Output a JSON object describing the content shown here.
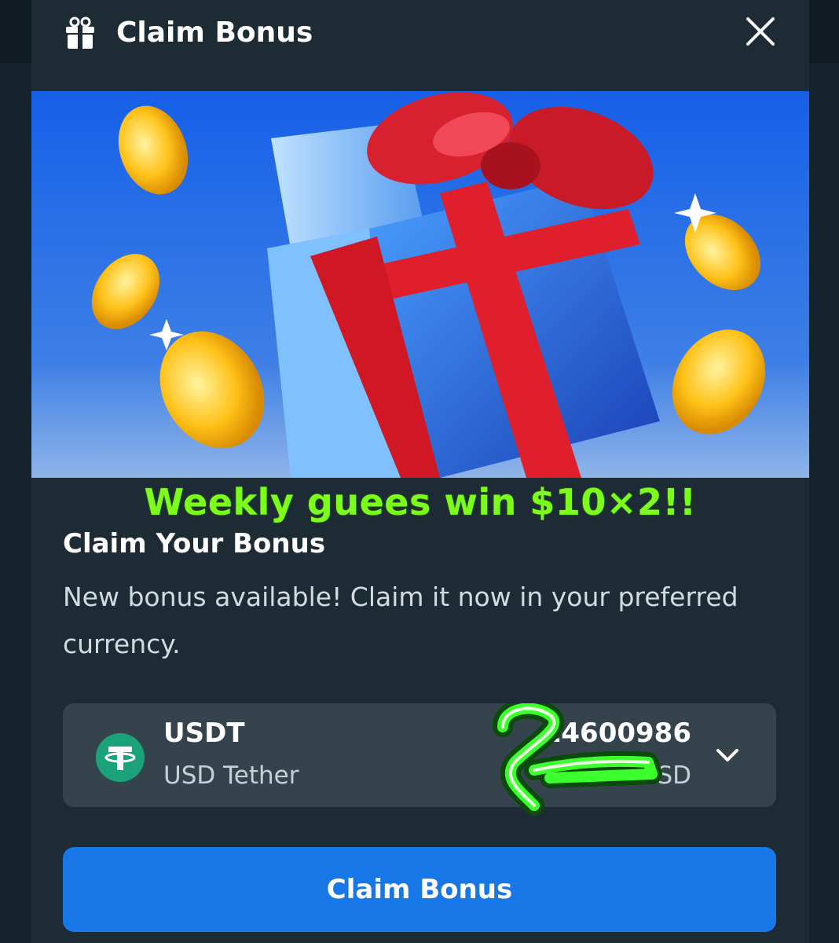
{
  "header": {
    "title": "Claim Bonus"
  },
  "promo_overlay": "Weekly guees win $10×2!!",
  "content": {
    "title": "Claim Your Bonus",
    "description": "New bonus available! Claim it now in your preferred currency."
  },
  "currency": {
    "code": "USDT",
    "name": "USD Tether",
    "amount_visible": "14600986",
    "usd_suffix_visible": "SD"
  },
  "claim_button": {
    "label": "Claim Bonus"
  },
  "colors": {
    "modal_bg": "#1d2b35",
    "card_bg": "#35434d",
    "accent_blue": "#1877e6",
    "promo_green": "#7cfc1a",
    "tether_green": "#1ba27a"
  },
  "icons": {
    "header": "gift-icon",
    "close": "close-icon",
    "currency": "tether-icon",
    "dropdown": "chevron-down-icon"
  }
}
